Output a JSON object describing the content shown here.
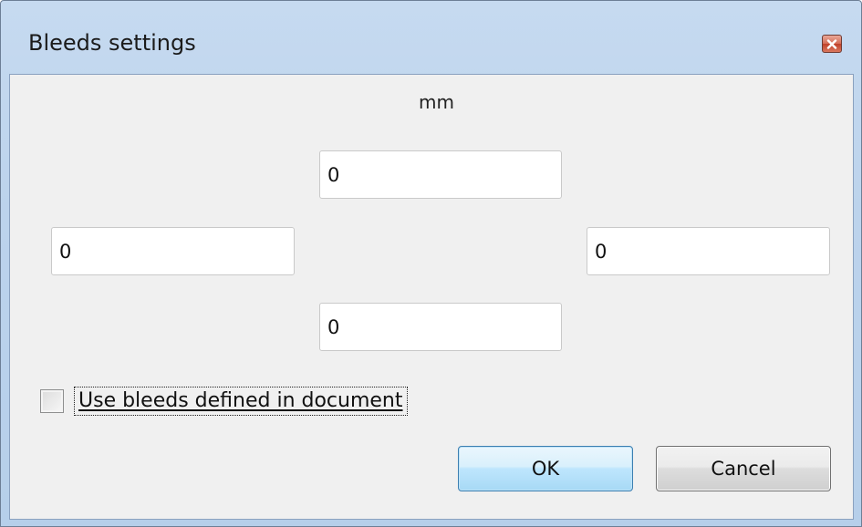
{
  "window": {
    "title": "Bleeds settings"
  },
  "icons": {
    "close": "close-icon"
  },
  "bleeds": {
    "unit": "mm",
    "top": "0",
    "left": "0",
    "right": "0",
    "bottom": "0"
  },
  "options": {
    "use_document_bleeds_label": "Use bleeds defined in document",
    "use_document_bleeds_checked": false
  },
  "buttons": {
    "ok": "OK",
    "cancel": "Cancel"
  },
  "colors": {
    "frame": "#bcd3ec",
    "client_background": "#f0f0f0",
    "close_button": "#c1412a",
    "default_button_border": "#3c7fb1"
  }
}
